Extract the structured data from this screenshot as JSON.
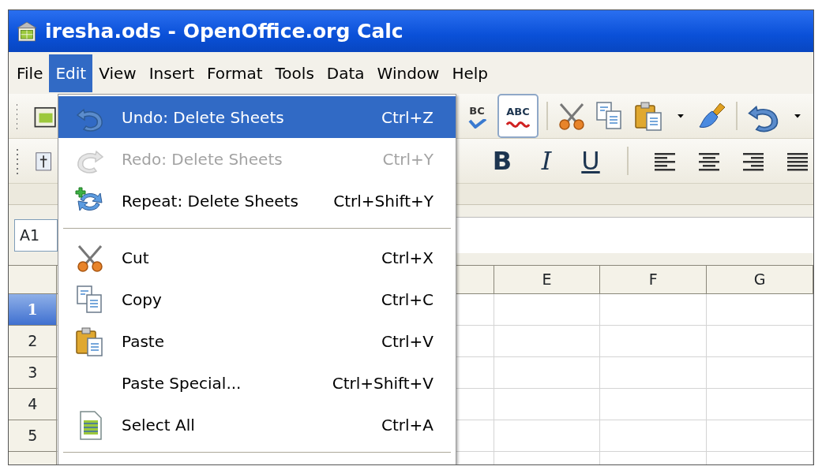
{
  "window": {
    "title": "iresha.ods - OpenOffice.org Calc"
  },
  "menu_bar": [
    {
      "label": "File",
      "selected": false
    },
    {
      "label": "Edit",
      "selected": true
    },
    {
      "label": "View",
      "selected": false
    },
    {
      "label": "Insert",
      "selected": false
    },
    {
      "label": "Format",
      "selected": false
    },
    {
      "label": "Tools",
      "selected": false
    },
    {
      "label": "Data",
      "selected": false
    },
    {
      "label": "Window",
      "selected": false
    },
    {
      "label": "Help",
      "selected": false
    }
  ],
  "standard_toolbar": {
    "spellcheck_label": "BC",
    "auto_spellcheck": {
      "label": "ABC",
      "on": true
    }
  },
  "formatting_toolbar": {
    "buttons": [
      {
        "label": "B",
        "kind": "bold"
      },
      {
        "label": "I",
        "kind": "italic"
      },
      {
        "label": "U",
        "kind": "underline"
      }
    ]
  },
  "name_box": {
    "value": "A1"
  },
  "columns": [
    {
      "label": "E"
    },
    {
      "label": "F"
    },
    {
      "label": "G"
    }
  ],
  "rows": [
    {
      "label": "1",
      "selected": true
    },
    {
      "label": "2",
      "selected": false
    },
    {
      "label": "3",
      "selected": false
    },
    {
      "label": "4",
      "selected": false
    },
    {
      "label": "5",
      "selected": false
    }
  ],
  "edit_menu": {
    "items": [
      {
        "kind": "undo",
        "label": "Undo: Delete Sheets",
        "shortcut": "Ctrl+Z",
        "selected": true,
        "disabled": false
      },
      {
        "kind": "redo",
        "label": "Redo: Delete Sheets",
        "shortcut": "Ctrl+Y",
        "selected": false,
        "disabled": true
      },
      {
        "kind": "repeat",
        "label": "Repeat: Delete Sheets",
        "shortcut": "Ctrl+Shift+Y",
        "selected": false,
        "disabled": false
      },
      {
        "kind": "separator"
      },
      {
        "kind": "cut",
        "label": "Cut",
        "shortcut": "Ctrl+X",
        "selected": false,
        "disabled": false
      },
      {
        "kind": "copy",
        "label": "Copy",
        "shortcut": "Ctrl+C",
        "selected": false,
        "disabled": false
      },
      {
        "kind": "paste",
        "label": "Paste",
        "shortcut": "Ctrl+V",
        "selected": false,
        "disabled": false
      },
      {
        "kind": "plain",
        "label": "Paste Special...",
        "shortcut": "Ctrl+Shift+V",
        "selected": false,
        "disabled": false
      },
      {
        "kind": "selectall",
        "label": "Select All",
        "shortcut": "Ctrl+A",
        "selected": false,
        "disabled": false
      },
      {
        "kind": "separator"
      }
    ]
  }
}
